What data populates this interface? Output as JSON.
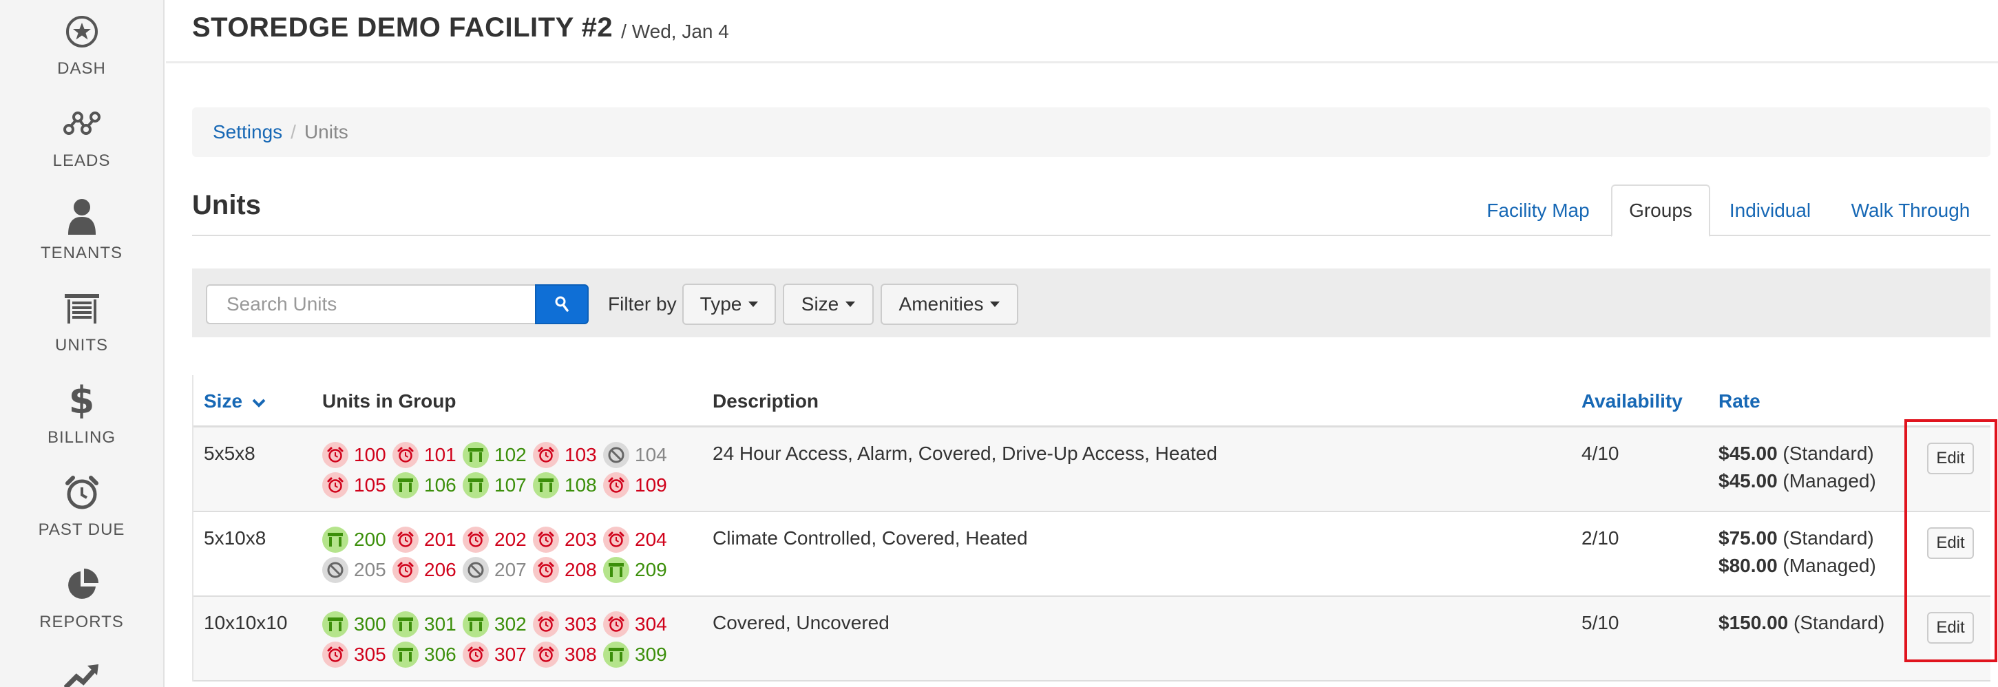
{
  "sidebar": {
    "items": [
      {
        "label": "DASH",
        "icon": "star-circle-icon"
      },
      {
        "label": "LEADS",
        "icon": "nodes-icon"
      },
      {
        "label": "TENANTS",
        "icon": "person-icon"
      },
      {
        "label": "UNITS",
        "icon": "storage-door-icon"
      },
      {
        "label": "BILLING",
        "icon": "dollar-icon"
      },
      {
        "label": "PAST DUE",
        "icon": "alarm-clock-icon"
      },
      {
        "label": "REPORTS",
        "icon": "pie-chart-icon"
      },
      {
        "label": "",
        "icon": "trending-up-icon"
      }
    ]
  },
  "header": {
    "title": "STOREDGE DEMO FACILITY #2",
    "date": "/ Wed, Jan 4"
  },
  "breadcrumb": {
    "root": "Settings",
    "separator": "/",
    "current": "Units"
  },
  "page": {
    "title": "Units",
    "tabs": [
      {
        "label": "Facility Map",
        "active": false
      },
      {
        "label": "Groups",
        "active": true
      },
      {
        "label": "Individual",
        "active": false
      },
      {
        "label": "Walk Through",
        "active": false
      }
    ]
  },
  "filters": {
    "search_placeholder": "Search Units",
    "filter_by": "Filter by",
    "type": "Type",
    "size": "Size",
    "amenities": "Amenities"
  },
  "table": {
    "headers": {
      "size": "Size",
      "units": "Units in Group",
      "description": "Description",
      "availability": "Availability",
      "rate": "Rate"
    },
    "rows": [
      {
        "size": "5x5x8",
        "units": [
          [
            {
              "n": "100",
              "s": "pd"
            },
            {
              "n": "101",
              "s": "pd"
            },
            {
              "n": "102",
              "s": "occ"
            },
            {
              "n": "103",
              "s": "pd"
            },
            {
              "n": "104",
              "s": "un"
            }
          ],
          [
            {
              "n": "105",
              "s": "pd"
            },
            {
              "n": "106",
              "s": "occ"
            },
            {
              "n": "107",
              "s": "occ"
            },
            {
              "n": "108",
              "s": "occ"
            },
            {
              "n": "109",
              "s": "pd"
            }
          ]
        ],
        "description": "24 Hour Access, Alarm, Covered, Drive-Up Access, Heated",
        "availability": "4/10",
        "rates": [
          {
            "amount": "$45.00",
            "type": "(Standard)"
          },
          {
            "amount": "$45.00",
            "type": "(Managed)"
          }
        ],
        "edit": "Edit"
      },
      {
        "size": "5x10x8",
        "units": [
          [
            {
              "n": "200",
              "s": "occ"
            },
            {
              "n": "201",
              "s": "pd"
            },
            {
              "n": "202",
              "s": "pd"
            },
            {
              "n": "203",
              "s": "pd"
            },
            {
              "n": "204",
              "s": "pd"
            }
          ],
          [
            {
              "n": "205",
              "s": "un"
            },
            {
              "n": "206",
              "s": "pd"
            },
            {
              "n": "207",
              "s": "un"
            },
            {
              "n": "208",
              "s": "pd"
            },
            {
              "n": "209",
              "s": "occ"
            }
          ]
        ],
        "description": "Climate Controlled, Covered, Heated",
        "availability": "2/10",
        "rates": [
          {
            "amount": "$75.00",
            "type": "(Standard)"
          },
          {
            "amount": "$80.00",
            "type": "(Managed)"
          }
        ],
        "edit": "Edit"
      },
      {
        "size": "10x10x10",
        "units": [
          [
            {
              "n": "300",
              "s": "occ"
            },
            {
              "n": "301",
              "s": "occ"
            },
            {
              "n": "302",
              "s": "occ"
            },
            {
              "n": "303",
              "s": "pd"
            },
            {
              "n": "304",
              "s": "pd"
            }
          ],
          [
            {
              "n": "305",
              "s": "pd"
            },
            {
              "n": "306",
              "s": "occ"
            },
            {
              "n": "307",
              "s": "pd"
            },
            {
              "n": "308",
              "s": "pd"
            },
            {
              "n": "309",
              "s": "occ"
            }
          ]
        ],
        "description": "Covered, Uncovered",
        "availability": "5/10",
        "rates": [
          {
            "amount": "$150.00",
            "type": "(Standard)"
          }
        ],
        "edit": "Edit"
      }
    ]
  },
  "colors": {
    "link": "#1768b5",
    "occupied": "#3c8f0b",
    "past_due": "#d0021b",
    "unavailable": "#888888",
    "highlight": "#e0141e"
  }
}
